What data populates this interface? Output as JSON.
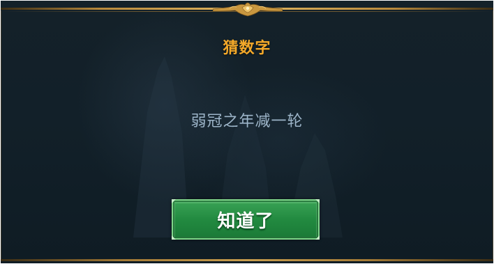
{
  "dialog": {
    "title": "猜数字",
    "riddle": "弱冠之年减一轮",
    "confirm_label": "知道了"
  },
  "colors": {
    "title": "#f4a92a",
    "riddle_text": "#9db5c9",
    "button_green": "#228a40",
    "frame_gold": "#c99e4e",
    "background": "#122029"
  },
  "icons": {
    "top_ornament": "gold-crest-ornament"
  }
}
